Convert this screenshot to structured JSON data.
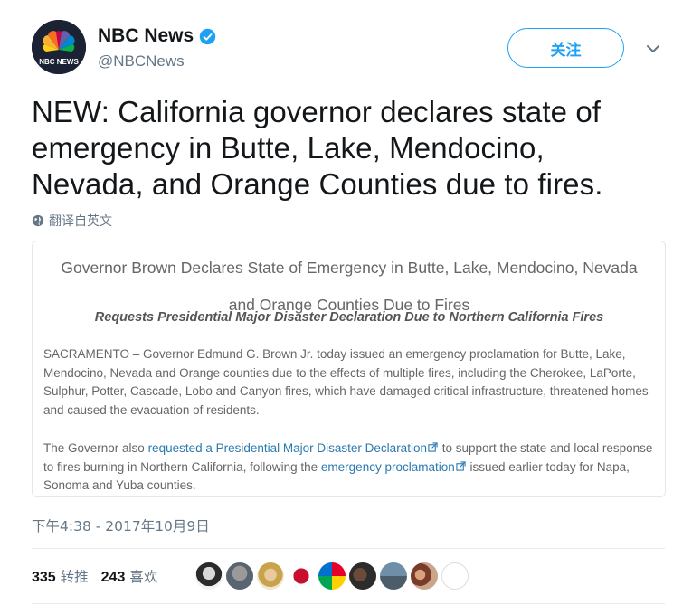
{
  "account": {
    "name": "NBC News",
    "handle": "@NBCNews",
    "avatar_text": "NBC NEWS",
    "verified": true
  },
  "follow_button": {
    "label": "关注"
  },
  "tweet": {
    "lines": [
      "NEW: California governor declares state of",
      "emergency in Butte, Lake, Mendocino,",
      "Nevada, and Orange Counties due to fires."
    ],
    "translate_label": "翻译自英文"
  },
  "card": {
    "title_line1": "Governor Brown Declares State of Emergency in Butte, Lake, Mendocino, Nevada",
    "title_line2": "and Orange Counties Due to Fires",
    "subtitle": "Requests Presidential Major Disaster Declaration Due to Northern California Fires",
    "para1": "SACRAMENTO – Governor Edmund G. Brown Jr. today issued an emergency proclamation for Butte, Lake, Mendocino, Nevada and Orange counties due to the effects of multiple fires, including the Cherokee, LaPorte, Sulphur, Potter, Cascade, Lobo and Canyon fires, which have damaged critical infrastructure, threatened homes and caused the evacuation of residents.",
    "para2_a": "The Governor also ",
    "para2_link1": "requested a Presidential Major Disaster Declaration",
    "para2_b": " to support the state and local response to fires burning in Northern California, following the ",
    "para2_link2": "emergency proclamation",
    "para2_c": " issued earlier today for Napa, Sonoma and Yuba counties."
  },
  "timestamp": "下午4:38 - 2017年10月9日",
  "stats": {
    "retweets_count": "335",
    "retweets_label": "转推",
    "likes_count": "243",
    "likes_label": "喜欢"
  },
  "colors": {
    "accent": "#1da1f2",
    "link": "#2a7ab0",
    "muted": "#657786"
  }
}
